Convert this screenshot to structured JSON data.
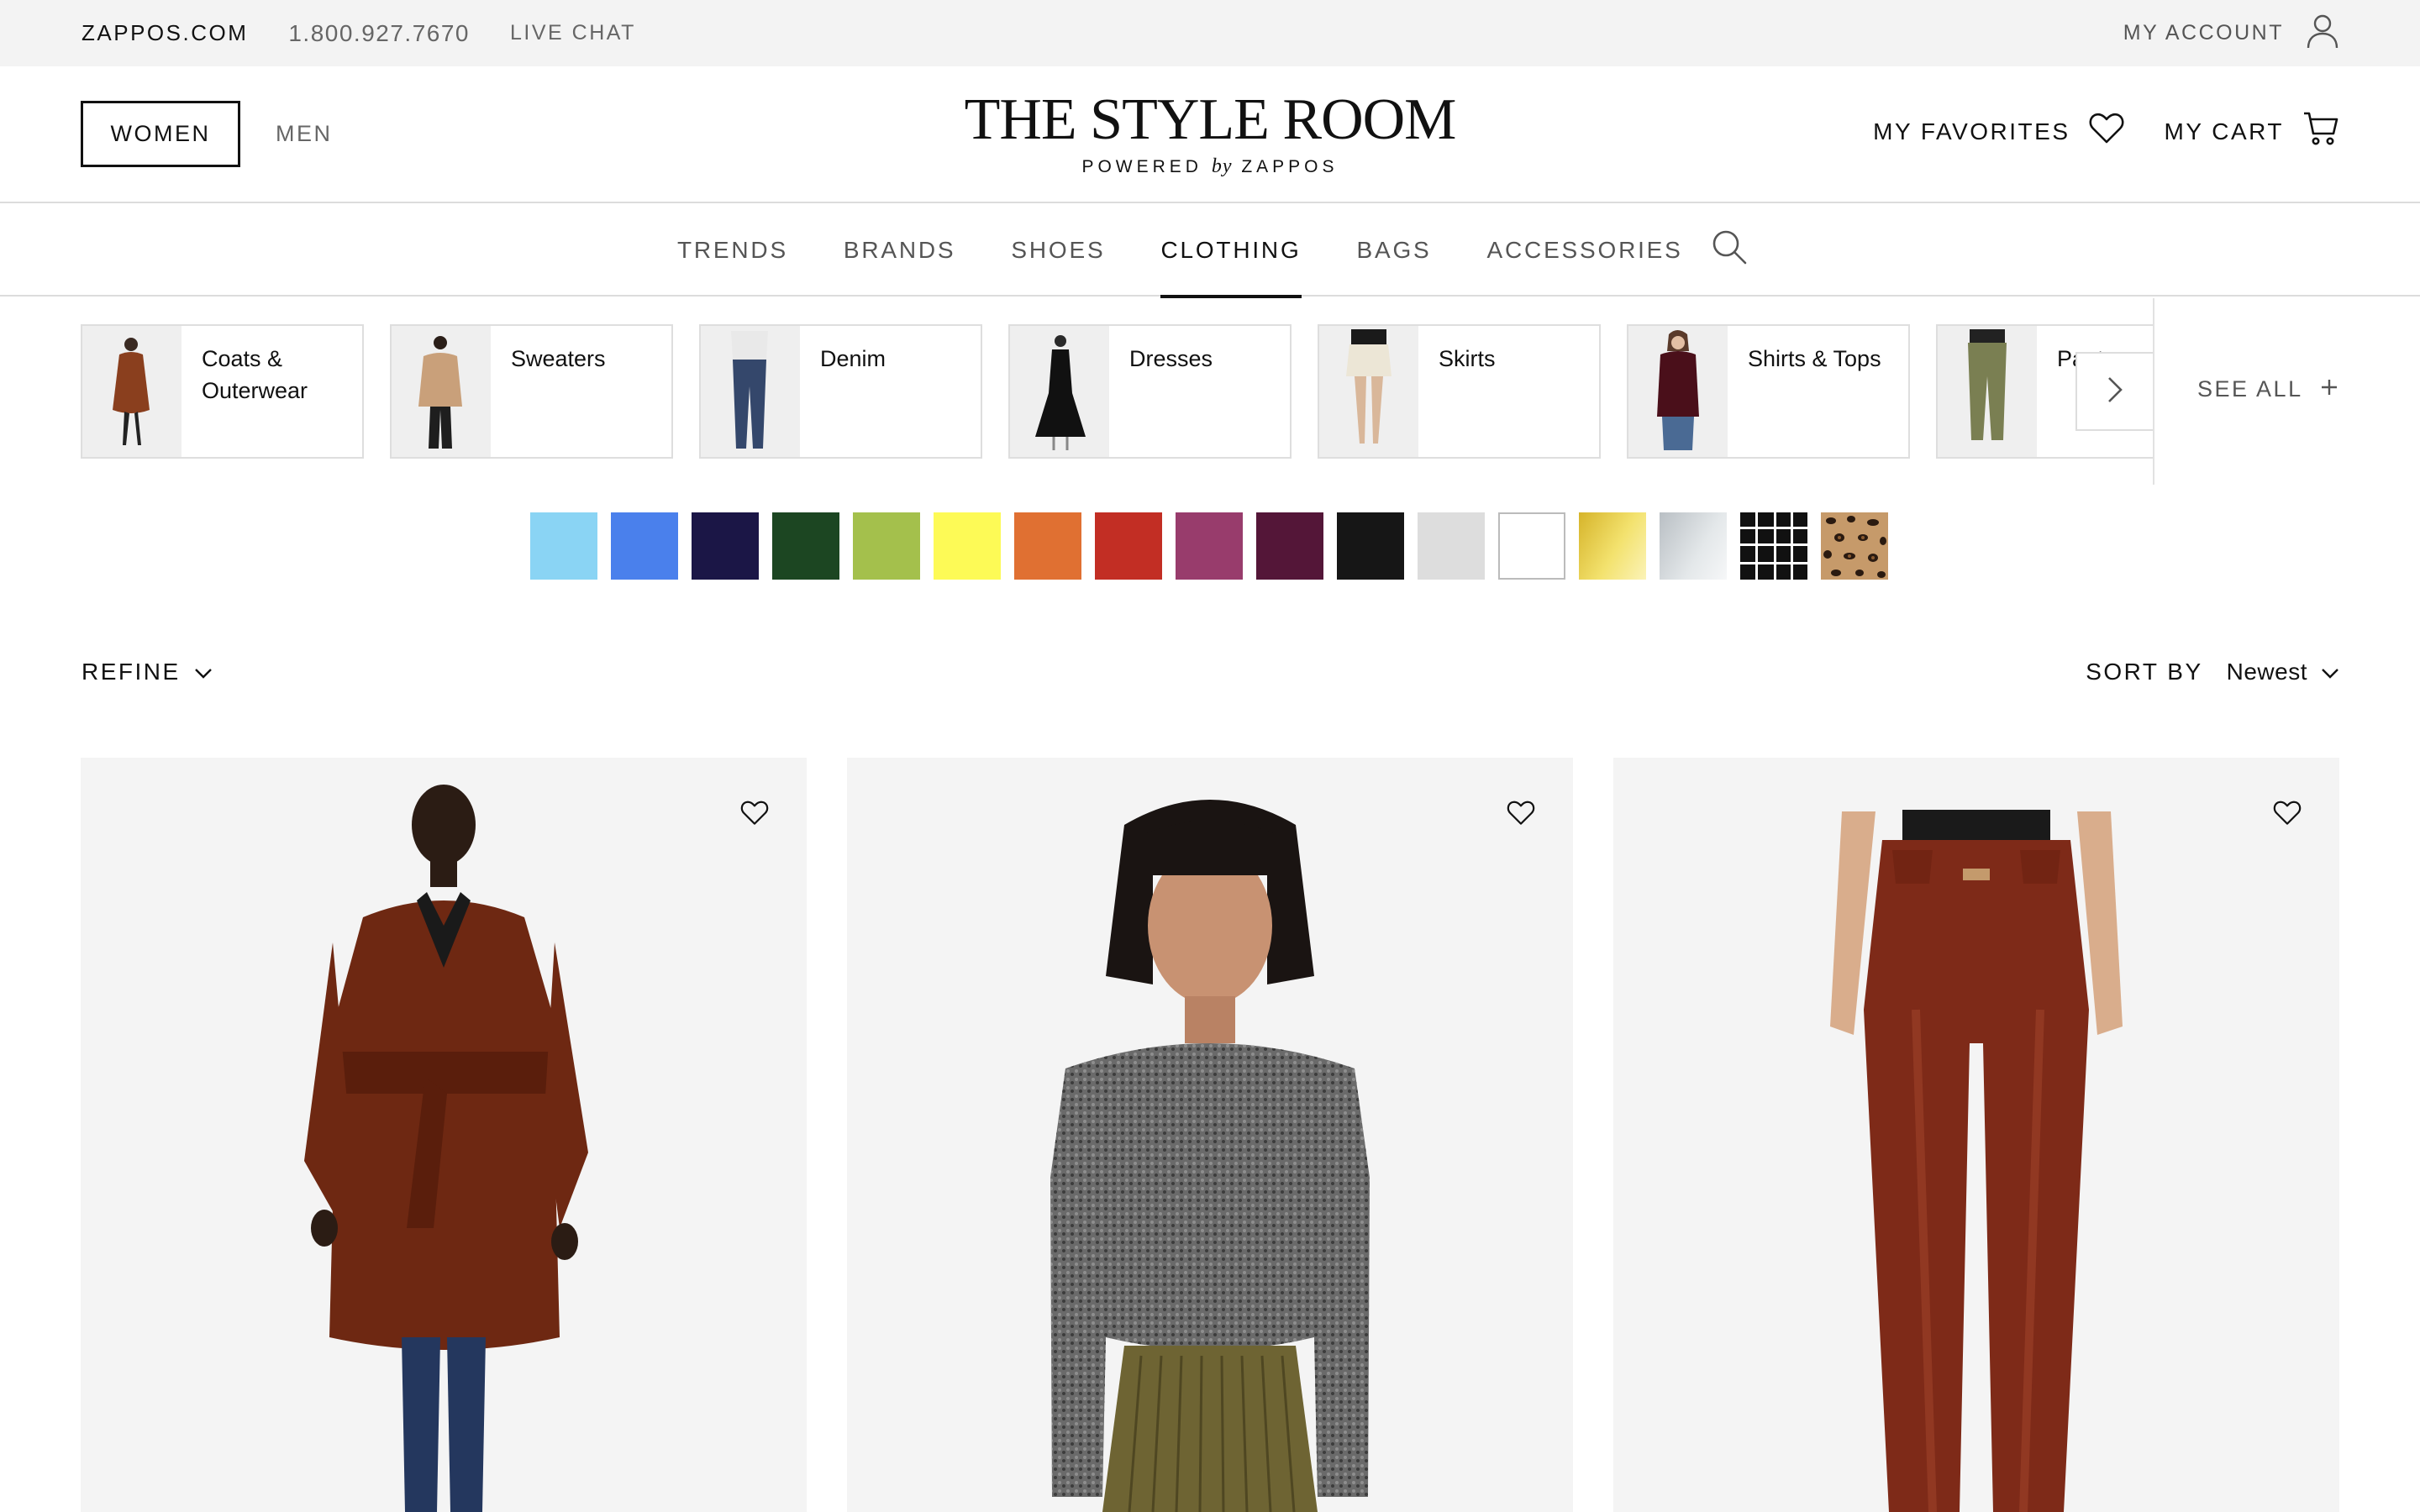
{
  "utility": {
    "site": "ZAPPOS.COM",
    "phone": "1.800.927.7670",
    "chat": "LIVE CHAT",
    "account": "MY ACCOUNT"
  },
  "header": {
    "women": "WOMEN",
    "men": "MEN",
    "logo_title": "THE STYLE ROOM",
    "logo_powered": "POWERED",
    "logo_by": "by",
    "logo_brand": "ZAPPOS",
    "favorites": "MY FAVORITES",
    "cart": "MY CART"
  },
  "nav": {
    "items": [
      {
        "label": "TRENDS",
        "active": false
      },
      {
        "label": "BRANDS",
        "active": false
      },
      {
        "label": "SHOES",
        "active": false
      },
      {
        "label": "CLOTHING",
        "active": true
      },
      {
        "label": "BAGS",
        "active": false
      },
      {
        "label": "ACCESSORIES",
        "active": false
      }
    ]
  },
  "categories": {
    "items": [
      {
        "label": "Coats & Outerwear"
      },
      {
        "label": "Sweaters"
      },
      {
        "label": "Denim"
      },
      {
        "label": "Dresses"
      },
      {
        "label": "Skirts"
      },
      {
        "label": "Shirts & Tops"
      },
      {
        "label": "Pants"
      }
    ],
    "see_all": "SEE ALL"
  },
  "swatches": [
    {
      "color": "#8ad4f4"
    },
    {
      "color": "#4a80ec"
    },
    {
      "color": "#1b1646"
    },
    {
      "color": "#1c4622"
    },
    {
      "color": "#a4c04c"
    },
    {
      "color": "#fdfa56"
    },
    {
      "color": "#e07032"
    },
    {
      "color": "#c22e24"
    },
    {
      "color": "#983c6c"
    },
    {
      "color": "#541638"
    },
    {
      "color": "#161616"
    },
    {
      "color": "#dddddd"
    },
    {
      "color": "#ffffff"
    },
    {
      "color": "gold-gradient"
    },
    {
      "color": "silver-gradient"
    },
    {
      "color": "plaid-pattern"
    },
    {
      "color": "leopard-pattern"
    }
  ],
  "toolbar": {
    "refine": "REFINE",
    "sort_label": "SORT BY",
    "sort_value": "Newest"
  },
  "products": [
    {
      "image": "faux-fur-belted-coat",
      "colors": {
        "main": "#7a2c16"
      }
    },
    {
      "image": "grey-knit-sweater",
      "colors": {
        "main": "#6d6d6d"
      }
    },
    {
      "image": "coated-skinny-jeans",
      "colors": {
        "main": "#8e3524"
      }
    }
  ]
}
